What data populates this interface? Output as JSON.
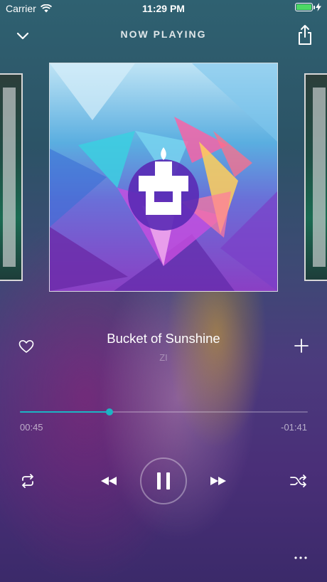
{
  "status_bar": {
    "carrier": "Carrier",
    "time": "11:29 PM",
    "battery_level": 1.0,
    "icons": [
      "wifi-icon",
      "battery-icon",
      "charging-bolt-icon"
    ]
  },
  "header": {
    "title": "NOW PLAYING",
    "icons": [
      "chevron-down-icon",
      "share-icon"
    ]
  },
  "track": {
    "title": "Bucket of Sunshine",
    "artist": "ZI",
    "elapsed": "00:45",
    "remaining": "-01:41",
    "progress": 0.31
  },
  "controls": [
    "heart-icon",
    "add-icon",
    "repeat-icon",
    "rewind-icon",
    "pause-icon",
    "fast-forward-icon",
    "shuffle-icon",
    "more-icon"
  ],
  "colors": {
    "accent": "#1cb4c4",
    "battery": "#4cd964"
  }
}
